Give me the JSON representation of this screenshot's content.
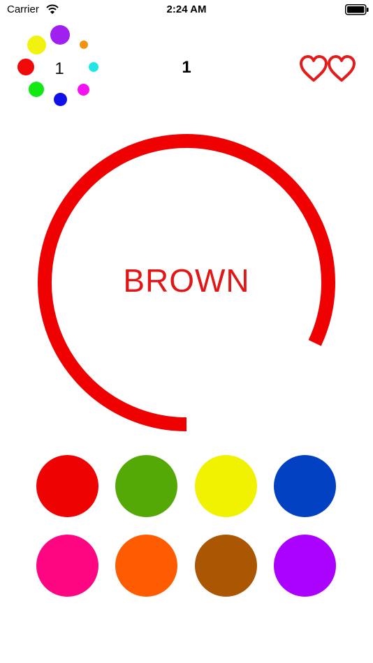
{
  "status_bar": {
    "carrier": "Carrier",
    "time": "2:24 AM"
  },
  "logo": {
    "number": "1",
    "dot_colors": [
      "#A020F0",
      "#F29411",
      "#22E6E6",
      "#F312F1",
      "#1010E8",
      "#12E812",
      "#F10808",
      "#F2F210"
    ]
  },
  "score": "1",
  "lives": {
    "count": 2,
    "color": "#E31B1B"
  },
  "timer": {
    "ring_color": "#EF0101",
    "remaining_fraction": 0.82
  },
  "target": {
    "word": "BROWN",
    "word_color": "#E31616"
  },
  "palette": [
    {
      "name": "red",
      "color": "#EE0202"
    },
    {
      "name": "green",
      "color": "#55A907"
    },
    {
      "name": "yellow",
      "color": "#F1F202"
    },
    {
      "name": "blue",
      "color": "#0241C2"
    },
    {
      "name": "pink",
      "color": "#FE0582"
    },
    {
      "name": "orange",
      "color": "#FF5C02"
    },
    {
      "name": "brown",
      "color": "#AA5602"
    },
    {
      "name": "purple",
      "color": "#AA02FD"
    }
  ]
}
